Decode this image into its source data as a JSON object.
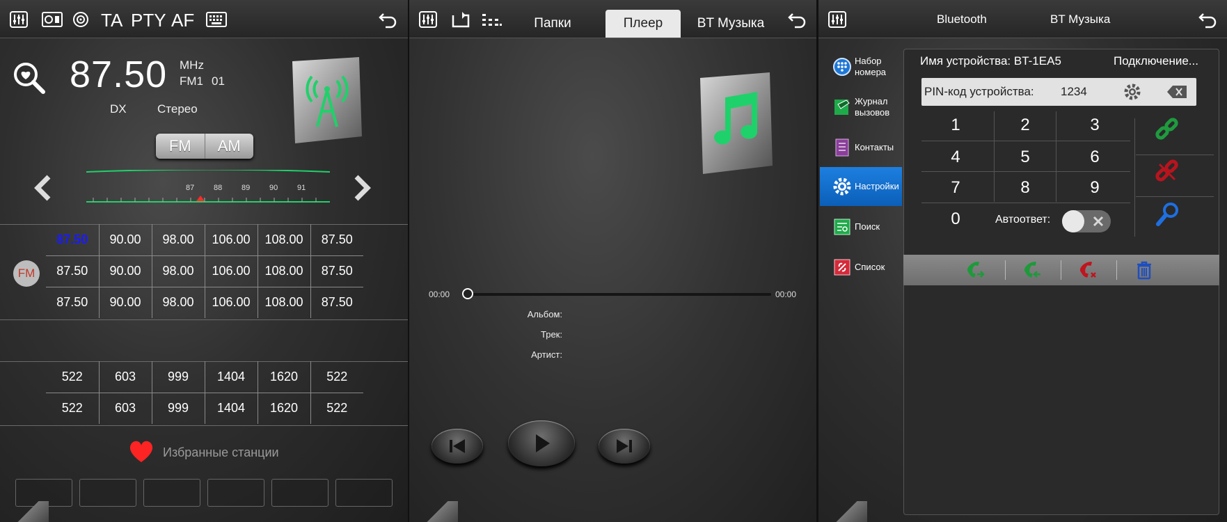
{
  "radio": {
    "topbar": {
      "ta": "TA",
      "pty": "PTY",
      "af": "AF"
    },
    "frequency": "87.50",
    "unit": "MHz",
    "band_info": "FM1",
    "preset_index": "01",
    "dx": "DX",
    "stereo": "Стерео",
    "band_fm": "FM",
    "band_am": "AM",
    "scale_ticks": [
      "87",
      "88",
      "89",
      "90",
      "91"
    ],
    "fm_badge": "FM",
    "fm_presets": [
      [
        "87.50",
        "90.00",
        "98.00",
        "106.00",
        "108.00",
        "87.50"
      ],
      [
        "87.50",
        "90.00",
        "98.00",
        "106.00",
        "108.00",
        "87.50"
      ],
      [
        "87.50",
        "90.00",
        "98.00",
        "106.00",
        "108.00",
        "87.50"
      ]
    ],
    "am_presets": [
      [
        "522",
        "603",
        "999",
        "1404",
        "1620",
        "522"
      ],
      [
        "522",
        "603",
        "999",
        "1404",
        "1620",
        "522"
      ]
    ],
    "favorites_label": "Избранные станции",
    "active_preset_color": "#1a1aff"
  },
  "player": {
    "tabs": [
      "Папки",
      "Плеер",
      "BT Музыка"
    ],
    "active_tab": "Плеер",
    "time_start": "00:00",
    "time_end": "00:00",
    "album_label": "Альбом:",
    "track_label": "Трек:",
    "artist_label": "Артист:",
    "accent": "#1fd16a"
  },
  "bluetooth": {
    "tabs": [
      "Bluetooth",
      "BT Музыка"
    ],
    "sidebar": [
      {
        "label": "Набор номера",
        "icon": "dialpad-icon"
      },
      {
        "label": "Журнал вызовов",
        "icon": "call-log-icon"
      },
      {
        "label": "Контакты",
        "icon": "contacts-icon"
      },
      {
        "label": "Настройки",
        "icon": "settings-icon"
      },
      {
        "label": "Поиск",
        "icon": "search-icon"
      },
      {
        "label": "Список",
        "icon": "list-icon"
      }
    ],
    "active_item": "Настройки",
    "device_name_label": "Имя устройства: BT-1EA5",
    "connection_label": "Подключение...",
    "pin_label": "PIN-код устройства:",
    "pin_value": "1234",
    "keys": [
      "1",
      "2",
      "3",
      "4",
      "5",
      "6",
      "7",
      "8",
      "9",
      "0"
    ],
    "auto_answer_label": "Автоответ:",
    "auto_answer_on": false
  }
}
